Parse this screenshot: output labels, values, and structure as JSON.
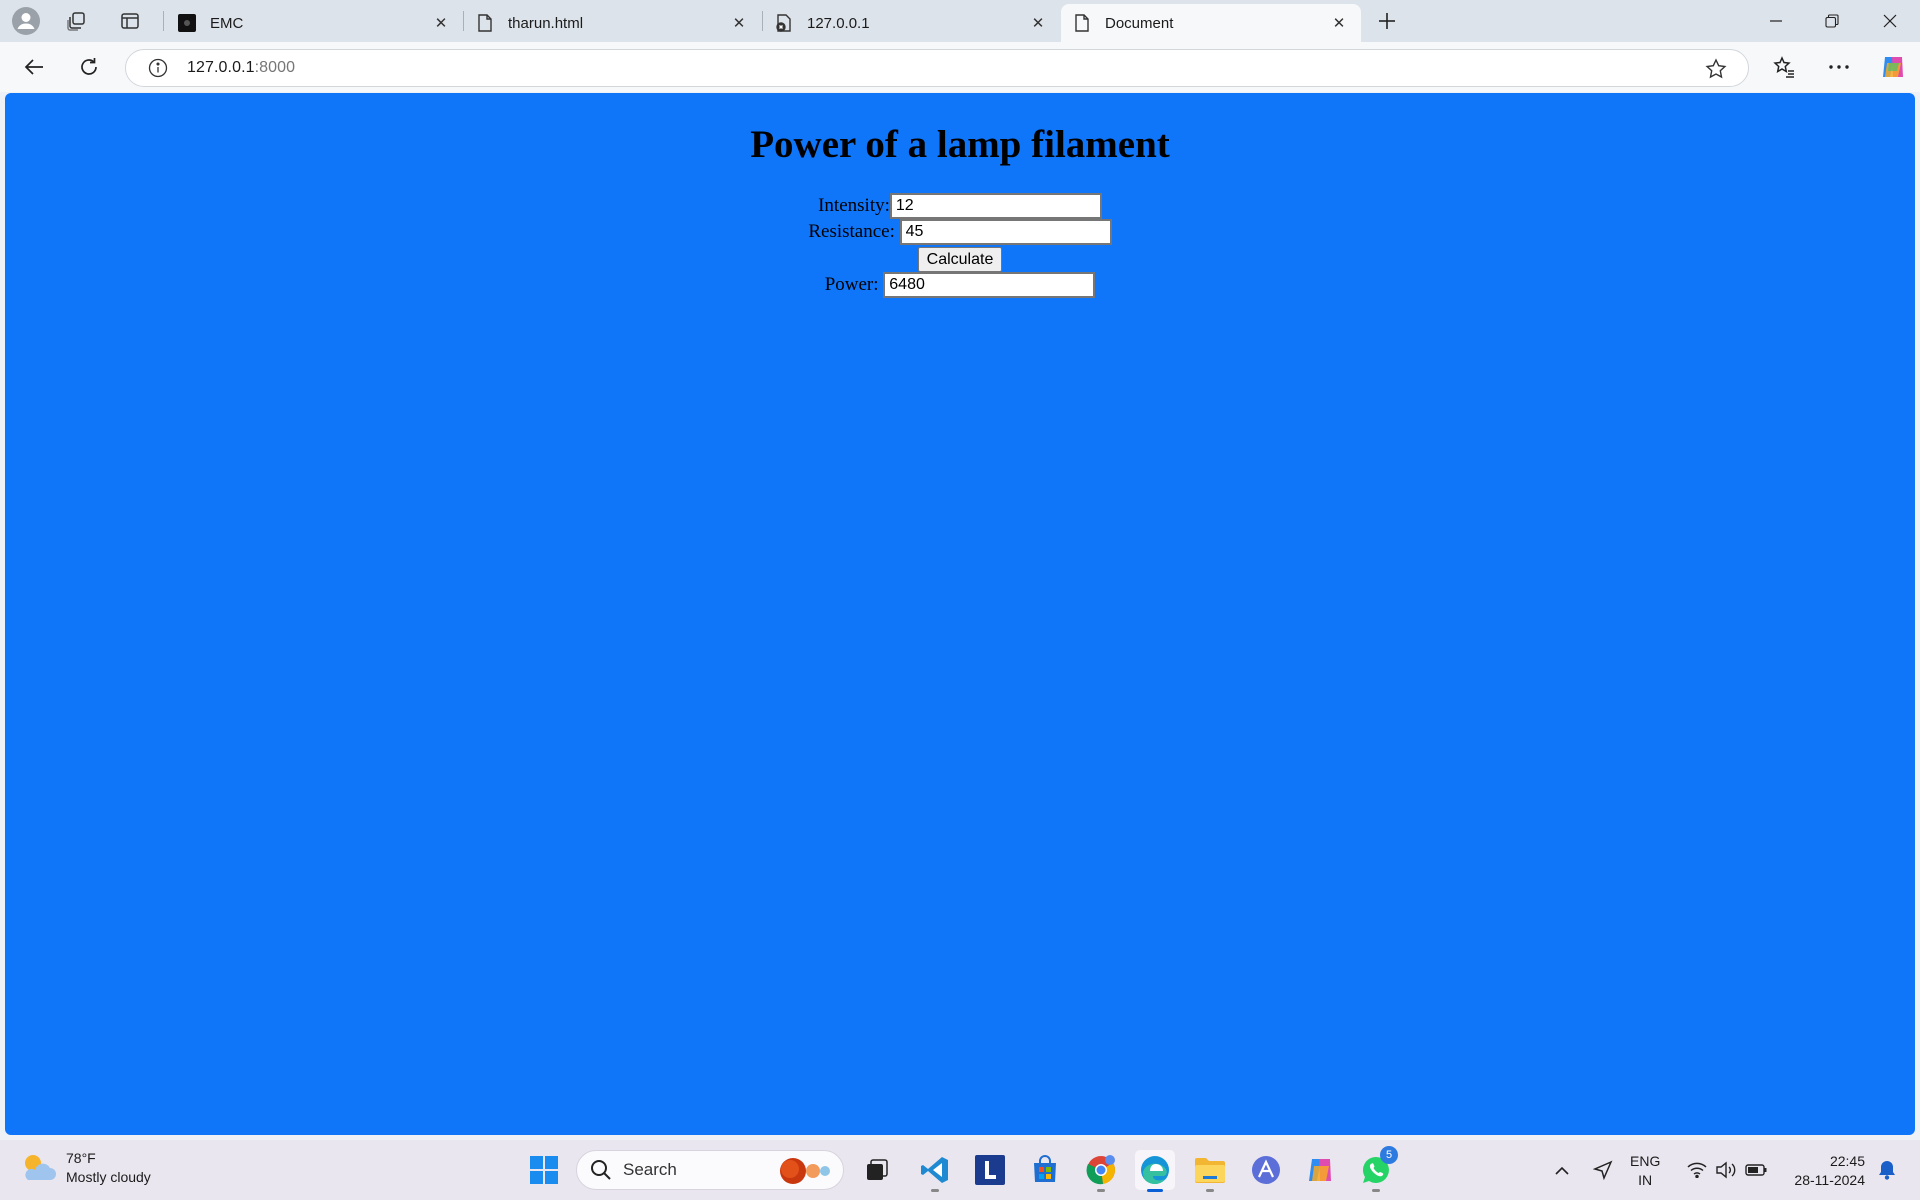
{
  "browser": {
    "tabs": [
      {
        "title": "EMC",
        "active": false
      },
      {
        "title": "tharun.html",
        "active": false
      },
      {
        "title": "127.0.0.1",
        "active": false
      },
      {
        "title": "Document",
        "active": true
      }
    ],
    "address": {
      "host": "127.0.0.1",
      "port": ":8000"
    }
  },
  "page": {
    "title": "Power of a lamp filament",
    "intensity_label": "Intensity:",
    "intensity_value": "12",
    "resistance_label": "Resistance:",
    "resistance_value": "45",
    "calculate_label": "Calculate",
    "power_label": "Power:",
    "power_value": "6480",
    "background_color": "#0f75f9"
  },
  "taskbar": {
    "weather_temp": "78°F",
    "weather_desc": "Mostly cloudy",
    "search_label": "Search",
    "whatsapp_badge": "5",
    "lang_line1": "ENG",
    "lang_line2": "IN",
    "time": "22:45",
    "date": "28-11-2024"
  }
}
